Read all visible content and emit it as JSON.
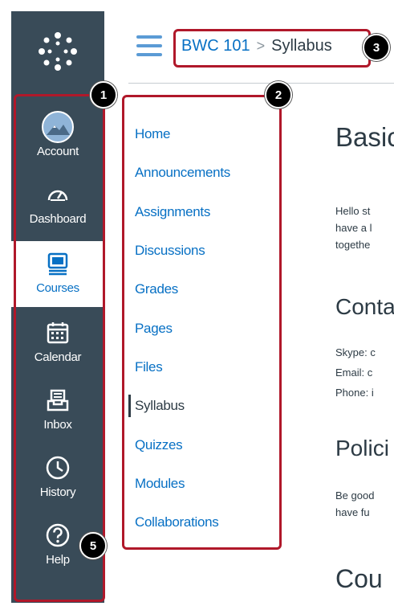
{
  "global_nav": {
    "items": [
      {
        "label": "Account",
        "icon": "avatar"
      },
      {
        "label": "Dashboard",
        "icon": "dashboard-icon"
      },
      {
        "label": "Courses",
        "icon": "courses-icon",
        "active": true
      },
      {
        "label": "Calendar",
        "icon": "calendar-icon"
      },
      {
        "label": "Inbox",
        "icon": "inbox-icon"
      },
      {
        "label": "History",
        "icon": "history-icon"
      },
      {
        "label": "Help",
        "icon": "help-icon"
      }
    ]
  },
  "header": {
    "course": "BWC 101",
    "separator": ">",
    "page": "Syllabus"
  },
  "course_nav": {
    "items": [
      "Home",
      "Announcements",
      "Assignments",
      "Discussions",
      "Grades",
      "Pages",
      "Files",
      "Syllabus",
      "Quizzes",
      "Modules",
      "Collaborations"
    ],
    "active": "Syllabus"
  },
  "content": {
    "heading_basic": "Basic",
    "intro_lines": [
      "Hello st",
      "have a l",
      "togethe"
    ],
    "heading_contact": "Conta",
    "contact_lines": [
      "Skype: c",
      "Email: c",
      "Phone: i"
    ],
    "heading_policies": "Polici",
    "policy_lines": [
      "Be good",
      "have fu"
    ],
    "heading_course": "Cou"
  },
  "callouts": [
    "1",
    "2",
    "3",
    "5"
  ],
  "colors": {
    "nav_bg": "#394b58",
    "link": "#0770c4",
    "callout": "#b0182a"
  }
}
